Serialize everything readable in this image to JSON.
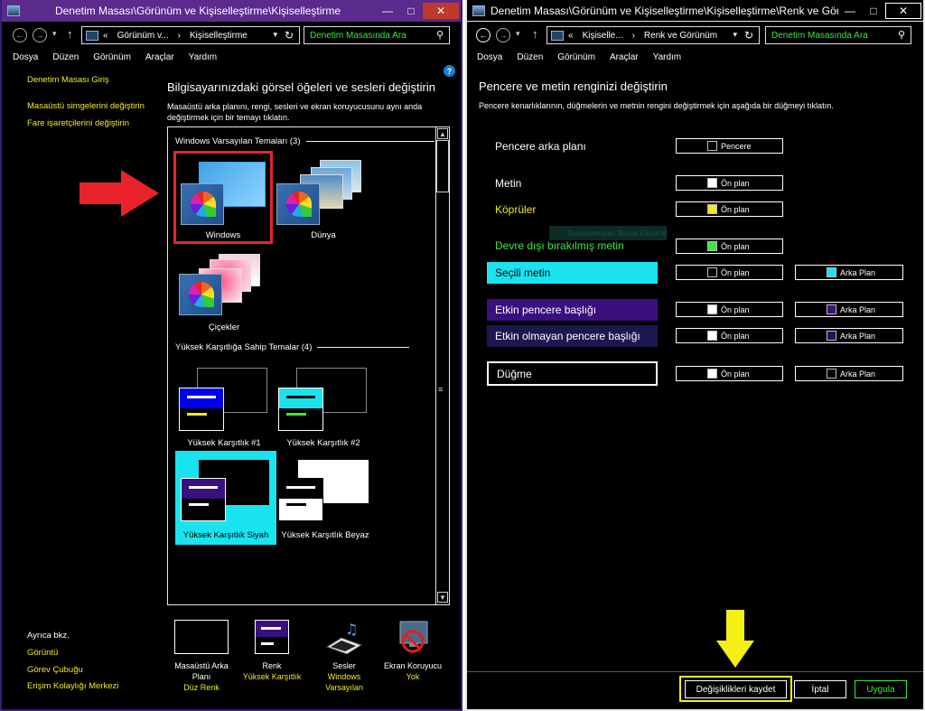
{
  "left_window": {
    "title": "Denetim Masası\\Görünüm ve Kişiselleştirme\\Kişiselleştirme",
    "address": {
      "prefix": "«",
      "seg1": "Görünüm v...",
      "sep": "›",
      "seg2": "Kişiselleştirme"
    },
    "search_placeholder": "Denetim Masasında Ara",
    "menu": [
      "Dosya",
      "Düzen",
      "Görünüm",
      "Araçlar",
      "Yardım"
    ],
    "sidebar": {
      "home": "Denetim Masası Giriş",
      "links": [
        "Masaüstü simgelerini değiştirin",
        "Fare işaretçilerini değiştirin"
      ],
      "see_also": "Ayrıca bkz.",
      "see_also_links": [
        "Görüntü",
        "Görev Çubuğu",
        "Erişim Kolaylığı Merkezi"
      ]
    },
    "heading": "Bilgisayarınızdaki görsel öğeleri ve sesleri değiştirin",
    "description_line1": "Masaüstü arka planını, rengi, sesleri ve ekran koruyucusunu aynı anda",
    "description_line2": "değiştirmek için bir temayı tıklatın.",
    "groups": {
      "default": "Windows Varsayılan Temaları (3)",
      "high_contrast": "Yüksek Karşıtlığa Sahip Temalar (4)"
    },
    "themes": [
      "Windows",
      "Dünya",
      "Çiçekler",
      "Yüksek Karşıtlık #1",
      "Yüksek Karşıtlık #2",
      "Yüksek Karşıtlık Siyah",
      "Yüksek Karşıtlık Beyaz"
    ],
    "bottom": [
      {
        "label1": "Masaüstü Arka",
        "label2": "Planı",
        "value": "Düz Renk"
      },
      {
        "label1": "Renk",
        "label2": "",
        "value": "Yüksek Karşıtlık"
      },
      {
        "label1": "Sesler",
        "label2": "",
        "value": "Windows Varsayılan"
      },
      {
        "label1": "Ekran Koruyucu",
        "label2": "",
        "value": "Yok"
      }
    ],
    "bottom_value_lines": {
      "sounds_1": "Windows",
      "sounds_2": "Varsayılan"
    }
  },
  "right_window": {
    "title": "Denetim Masası\\Görünüm ve Kişiselleştirme\\Kişiselleştirme\\Renk ve Görün...",
    "address": {
      "prefix": "«",
      "seg1": "Kişiselle...",
      "sep": "›",
      "seg2": "Renk ve Görünüm"
    },
    "search_placeholder": "Denetim Masasında Ara",
    "menu": [
      "Dosya",
      "Düzen",
      "Görünüm",
      "Araçlar",
      "Yardım"
    ],
    "heading": "Pencere ve metin renginizi değiştirin",
    "description": "Pencere kenarlıklarının, düğmelerin ve metnin rengini değiştirmek için aşağıda bir düğmeyi tıklatın.",
    "ghost_text": "Dokunulmayan Biçimli Ekran Metni",
    "items": {
      "window_bg": "Pencere arka planı",
      "text": "Metin",
      "links": "Köprüler",
      "disabled": "Devre dışı bırakılmış metin",
      "selected": "Seçili metin",
      "active_title": "Etkin pencere başlığı",
      "inactive_title": "Etkin olmayan pencere başlığı",
      "button": "Düğme"
    },
    "btn_labels": {
      "window": "Pencere",
      "fg": "Ön plan",
      "bg": "Arka Plan"
    },
    "footer": {
      "save": "Değişiklikleri kaydet",
      "cancel": "İptal",
      "apply": "Uygula"
    }
  },
  "colors": {
    "link": "#f0ea20",
    "disabled": "#3ce83c",
    "selected_bg": "#1ae3f0",
    "active_title_bg": "#3a0f7e",
    "inactive_title_bg": "#1d1751",
    "highlight_red": "#e8232a",
    "highlight_yellow": "#f4ef14"
  }
}
